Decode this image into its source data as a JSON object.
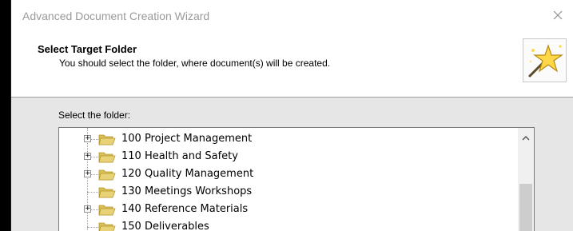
{
  "window": {
    "title": "Advanced Document Creation Wizard",
    "close_icon": "close-icon"
  },
  "header": {
    "title": "Select Target Folder",
    "subtitle": "You should select the folder, where document(s) will be created.",
    "icon": "magic-wand-star-icon"
  },
  "body": {
    "folder_label": "Select the folder:",
    "tree": [
      {
        "label": "100 Project Management",
        "expandable": true,
        "expander": "+"
      },
      {
        "label": "110 Health and Safety",
        "expandable": true,
        "expander": "+"
      },
      {
        "label": "120 Quality Management",
        "expandable": true,
        "expander": "+"
      },
      {
        "label": "130 Meetings Workshops",
        "expandable": false,
        "expander": ""
      },
      {
        "label": "140 Reference Materials",
        "expandable": true,
        "expander": "+"
      },
      {
        "label": "150 Deliverables",
        "expandable": false,
        "expander": ""
      }
    ],
    "scrollbar": {
      "up_icon": "chevron-up-icon"
    }
  },
  "colors": {
    "title_text": "#9a9a9a",
    "body_background": "#e6e6e6",
    "folder_fill": "#e8d277",
    "folder_edge": "#b8962e"
  }
}
